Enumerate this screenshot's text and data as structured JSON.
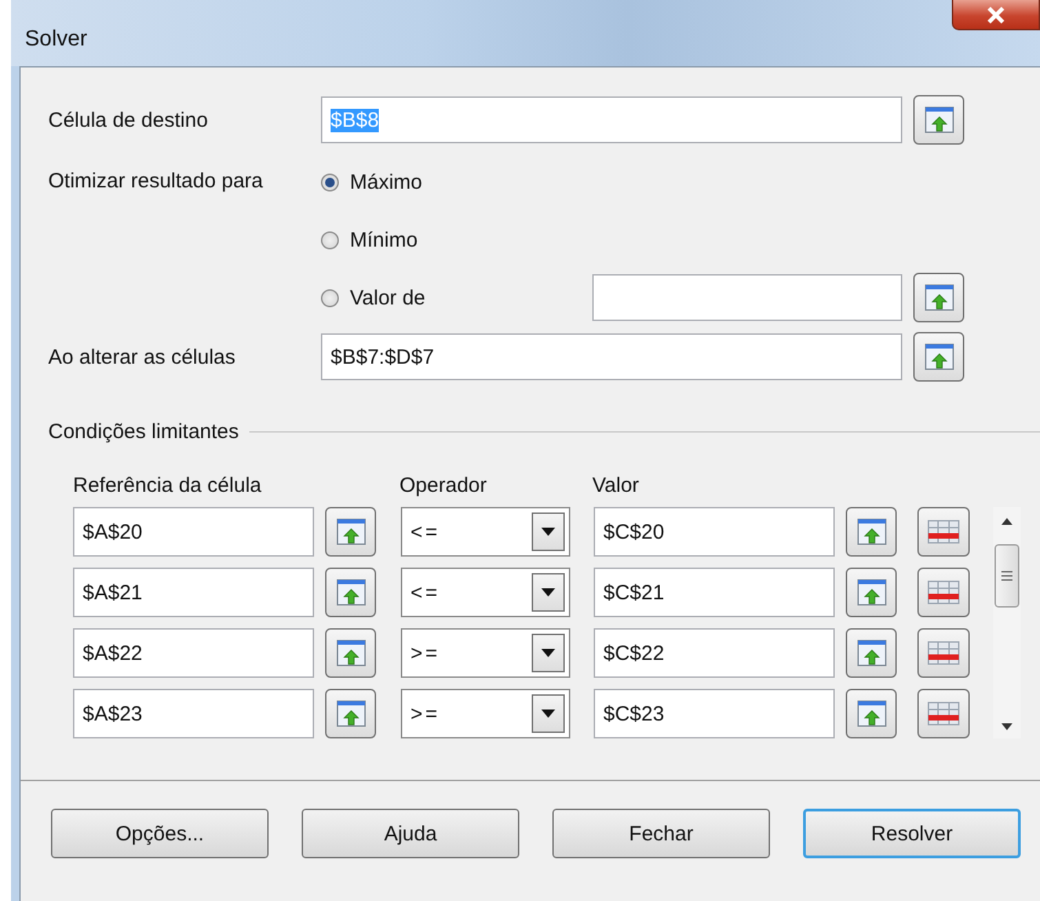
{
  "window": {
    "title": "Solver"
  },
  "target_cell": {
    "label": "Célula de destino",
    "value": "$B$8",
    "text_selected": true
  },
  "optimize": {
    "label": "Otimizar resultado para",
    "options": [
      {
        "label": "Máximo",
        "selected": true,
        "kind": "plain"
      },
      {
        "label": "Mínimo",
        "selected": false,
        "kind": "plain"
      },
      {
        "label": "Valor de",
        "selected": false,
        "kind": "value"
      }
    ]
  },
  "changing_cells": {
    "label": "Ao alterar as células",
    "value": "$B$7:$D$7"
  },
  "conditions": {
    "title": "Condições limitantes",
    "columns": [
      "Referência da célula",
      "Operador",
      "Valor"
    ],
    "rows": [
      {
        "reference": "$A$20",
        "operator": "<=",
        "value": "$C$20"
      },
      {
        "reference": "$A$21",
        "operator": "<=",
        "value": "$C$21"
      },
      {
        "reference": "$A$22",
        "operator": ">=",
        "value": "$C$22"
      },
      {
        "reference": "$A$23",
        "operator": ">=",
        "value": "$C$23"
      }
    ]
  },
  "buttons": [
    {
      "label": "Opções...",
      "default": false
    },
    {
      "label": "Ajuda",
      "default": false
    },
    {
      "label": "Fechar",
      "default": false
    },
    {
      "label": "Resolver",
      "default": true
    }
  ]
}
